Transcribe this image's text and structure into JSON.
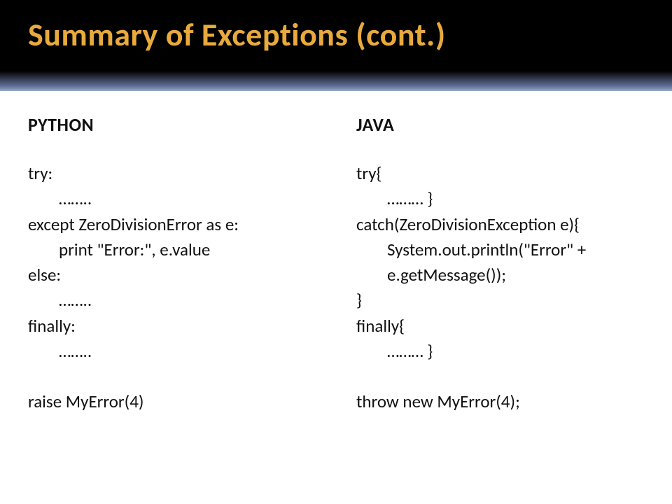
{
  "title": "Summary of Exceptions (cont.)",
  "columns": {
    "python": {
      "header": "PYTHON",
      "lines": [
        "try:",
        "    ……..",
        "except ZeroDivisionError as e:",
        "    print \"Error:\", e.value",
        "else:",
        "    ……..",
        "finally:",
        "    ……..",
        "",
        "raise MyError(4)"
      ]
    },
    "java": {
      "header": "JAVA",
      "lines": [
        "try{",
        "    ……… }",
        "catch(ZeroDivisionException e){",
        "    System.out.println(\"Error\" +",
        "    e.getMessage());",
        "}",
        "finally{",
        "    ……… }",
        "",
        "throw new MyError(4);"
      ]
    }
  }
}
